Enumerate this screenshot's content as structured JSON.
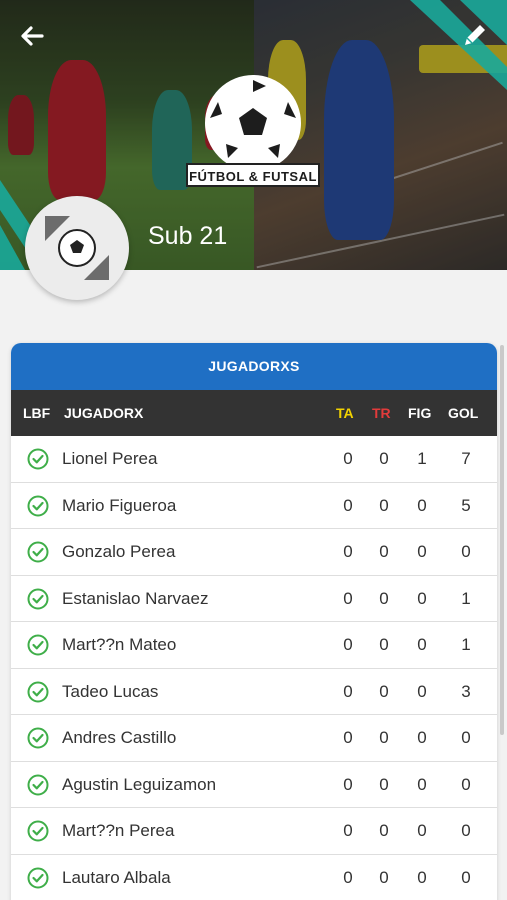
{
  "header": {
    "back_icon": "arrow-left-icon",
    "edit_icon": "pencil-icon",
    "brand_text": "FÚTBOL & FUTSAL",
    "team_name": "Sub 21"
  },
  "colors": {
    "accent_blue": "#1f6fc4",
    "header_dark": "#333333",
    "ta_yellow": "#f2d200",
    "tr_red": "#e23b3b",
    "check_green": "#3fae49",
    "teal": "#1aa99a"
  },
  "table": {
    "title": "JUGADORXS",
    "columns": {
      "lbf": "LBF",
      "player": "JUGADORX",
      "ta": "TA",
      "tr": "TR",
      "fig": "FIG",
      "gol": "GOL"
    },
    "rows": [
      {
        "name": "Lionel Perea",
        "ta": "0",
        "tr": "0",
        "fig": "1",
        "gol": "7"
      },
      {
        "name": "Mario Figueroa",
        "ta": "0",
        "tr": "0",
        "fig": "0",
        "gol": "5"
      },
      {
        "name": "Gonzalo Perea",
        "ta": "0",
        "tr": "0",
        "fig": "0",
        "gol": "0"
      },
      {
        "name": "Estanislao Narvaez",
        "ta": "0",
        "tr": "0",
        "fig": "0",
        "gol": "1"
      },
      {
        "name": "Mart??n Mateo",
        "ta": "0",
        "tr": "0",
        "fig": "0",
        "gol": "1"
      },
      {
        "name": "Tadeo Lucas",
        "ta": "0",
        "tr": "0",
        "fig": "0",
        "gol": "3"
      },
      {
        "name": "Andres Castillo",
        "ta": "0",
        "tr": "0",
        "fig": "0",
        "gol": "0"
      },
      {
        "name": "Agustin Leguizamon",
        "ta": "0",
        "tr": "0",
        "fig": "0",
        "gol": "0"
      },
      {
        "name": "Mart??n Perea",
        "ta": "0",
        "tr": "0",
        "fig": "0",
        "gol": "0"
      },
      {
        "name": "Lautaro Albala",
        "ta": "0",
        "tr": "0",
        "fig": "0",
        "gol": "0"
      }
    ]
  }
}
